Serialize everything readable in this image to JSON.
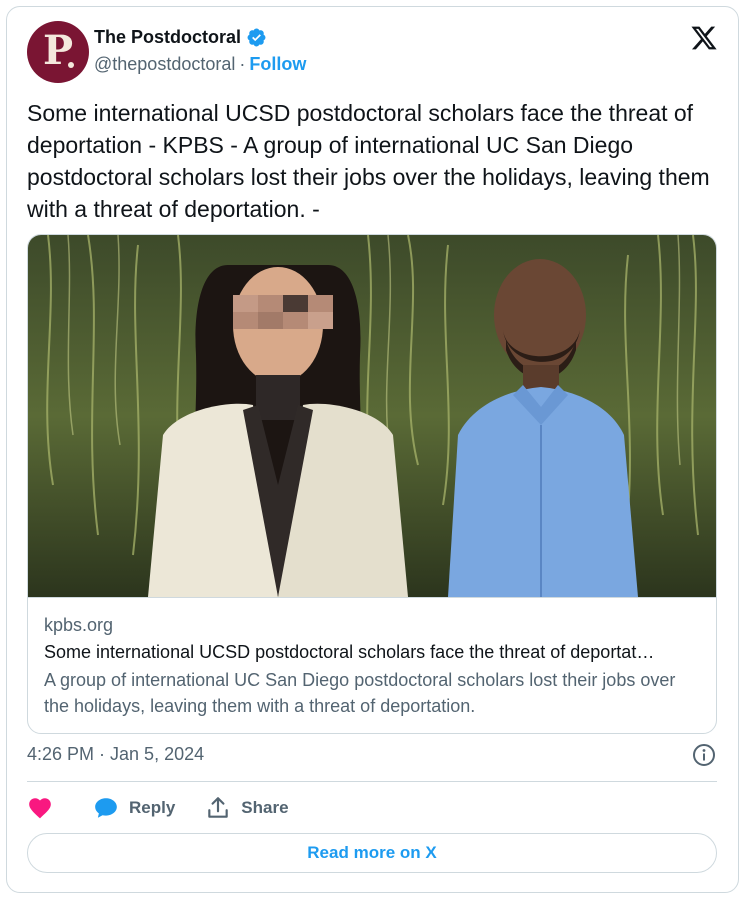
{
  "author": {
    "display_name": "The Postdoctoral",
    "handle": "@thepostdoctoral",
    "separator": "·",
    "follow_label": "Follow",
    "avatar_letter": "P",
    "avatar_color": "#7a1533"
  },
  "tweet": {
    "text": "Some international UCSD postdoctoral scholars face the threat of deportation - KPBS - A group of international UC San Diego postdoctoral scholars lost their jobs over the holidays, leaving them with a threat of deportation. -",
    "timestamp": "4:26 PM · Jan 5, 2024"
  },
  "link_card": {
    "domain": "kpbs.org",
    "title": "Some international UCSD postdoctoral scholars face the threat of deportat…",
    "description": "A group of international UC San Diego postdoctoral scholars lost their jobs over the holidays, leaving them with a threat of deportation."
  },
  "actions": {
    "like_icon": "heart-icon",
    "reply_label": "Reply",
    "share_label": "Share"
  },
  "read_more_label": "Read more on X",
  "colors": {
    "accent": "#1d9bf0",
    "like": "#f91880",
    "muted": "#536471",
    "border": "#cfd9de"
  }
}
